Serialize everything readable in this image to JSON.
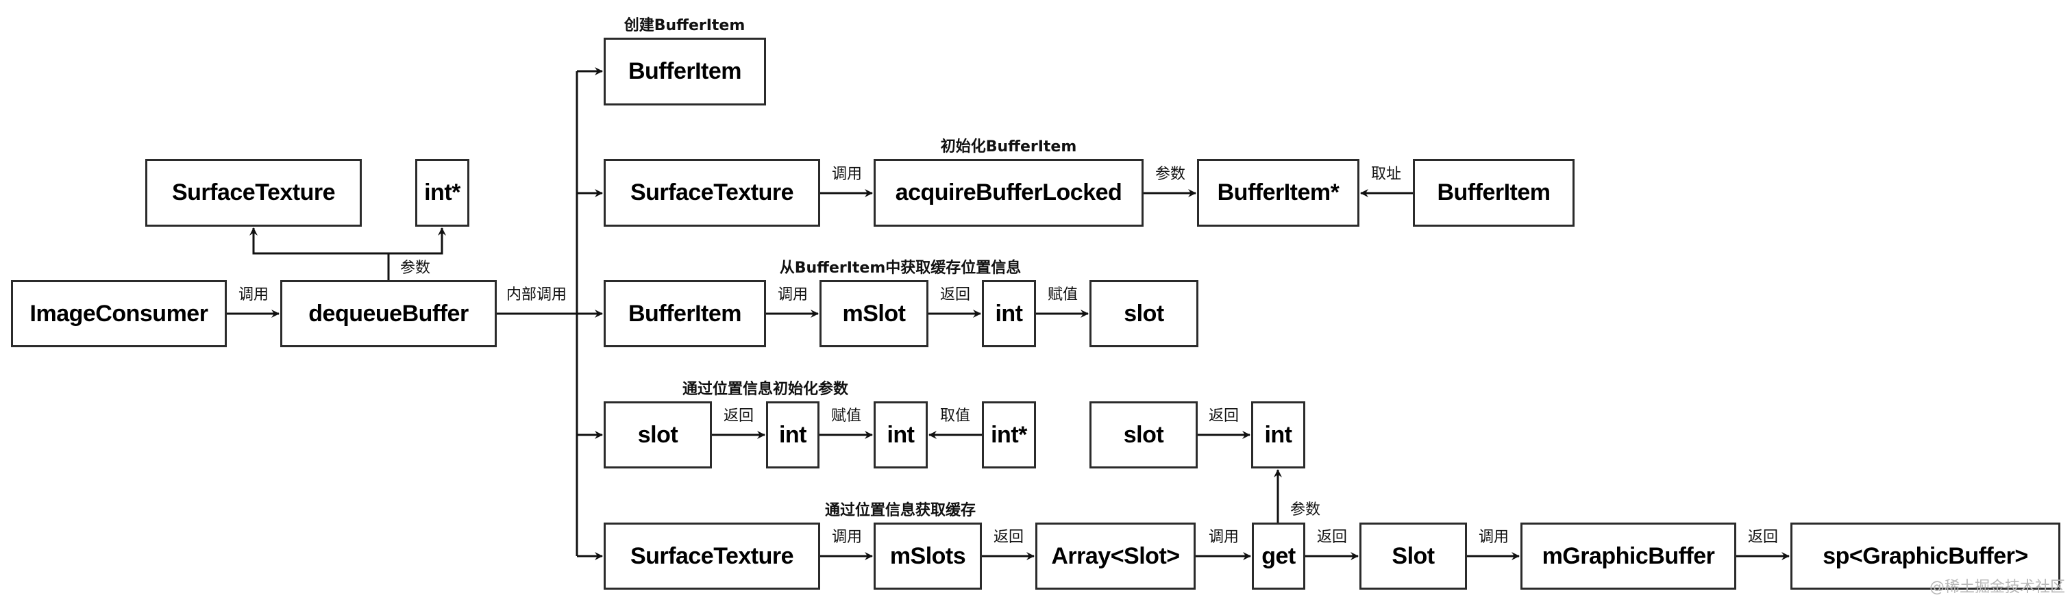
{
  "diagram": {
    "nodes": {
      "image_consumer": "ImageConsumer",
      "dequeue_buffer": "dequeueBuffer",
      "surface_texture_param": "SurfaceTexture",
      "int_ptr_param": "int*",
      "row1_buffer_item": "BufferItem",
      "row2_surface_texture": "SurfaceTexture",
      "row2_acquire_buffer_locked": "acquireBufferLocked",
      "row2_buffer_item_ptr": "BufferItem*",
      "row2_buffer_item": "BufferItem",
      "row3_buffer_item": "BufferItem",
      "row3_mslot": "mSlot",
      "row3_int": "int",
      "row3_slot": "slot",
      "row4_slot": "slot",
      "row4_int_a": "int",
      "row4_int_b": "int",
      "row4_int_ptr": "int*",
      "row4_slot_2": "slot",
      "row4_int_c": "int",
      "row5_surface_texture": "SurfaceTexture",
      "row5_mslots": "mSlots",
      "row5_array_slot": "Array<Slot>",
      "row5_get": "get",
      "row5_slot": "Slot",
      "row5_mgraphic_buffer": "mGraphicBuffer",
      "row5_sp_graphic_buffer": "sp<GraphicBuffer>"
    },
    "edge_labels": {
      "consumer_to_dequeue": "调用",
      "dequeue_params": "参数",
      "internal_call": "内部调用",
      "row2_call": "调用",
      "row2_param": "参数",
      "row2_take_address": "取址",
      "row3_call": "调用",
      "row3_return": "返回",
      "row3_assign": "赋值",
      "row4_return": "返回",
      "row4_assign": "赋值",
      "row4_take_value": "取值",
      "row4b_return": "返回",
      "get_param": "参数",
      "row5_call": "调用",
      "row5_return": "返回",
      "row5_call_get": "调用",
      "row5_get_return": "返回",
      "row5_slot_call": "调用",
      "row5_final_return": "返回"
    },
    "group_labels": {
      "row1": "创建BufferItem",
      "row2": "初始化BufferItem",
      "row3": "从BufferItem中获取缓存位置信息",
      "row4": "通过位置信息初始化参数",
      "row5": "通过位置信息获取缓存"
    }
  },
  "watermark": "@稀土掘金技术社区"
}
